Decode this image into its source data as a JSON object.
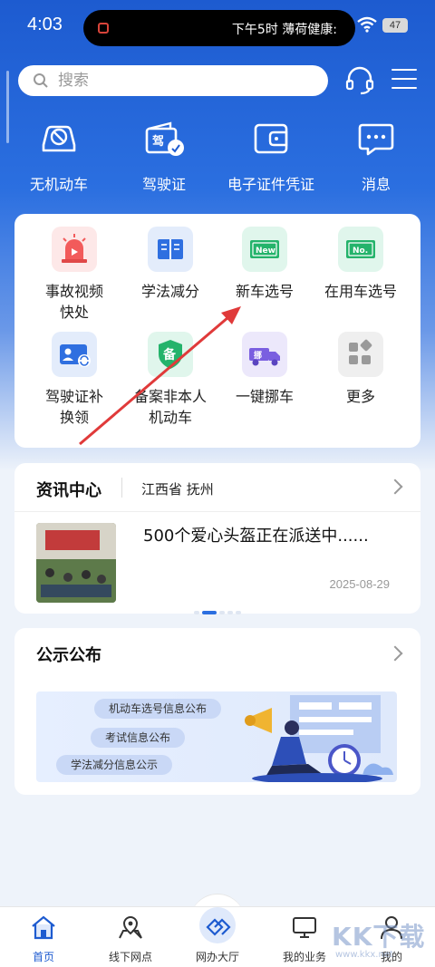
{
  "status_bar": {
    "time": "4:03",
    "notification": "下午5时 薄荷健康:",
    "battery": "47"
  },
  "search": {
    "placeholder": "搜索"
  },
  "top_services": [
    {
      "label": "无机动车",
      "icon": "no-vehicle-icon"
    },
    {
      "label": "驾驶证",
      "icon": "license-icon"
    },
    {
      "label": "电子证件凭证",
      "icon": "wallet-icon"
    },
    {
      "label": "消息",
      "icon": "message-icon"
    }
  ],
  "grid": [
    {
      "label": "事故视频快处",
      "icon": "alarm-video-icon",
      "color": "#fde8e8"
    },
    {
      "label": "学法减分",
      "icon": "book-icon",
      "color": "#e3ecfb"
    },
    {
      "label": "新车选号",
      "icon": "new-plate-icon",
      "color": "#e0f6ec"
    },
    {
      "label": "在用车选号",
      "icon": "no-plate-icon",
      "color": "#e0f6ec"
    },
    {
      "label": "驾驶证补换领",
      "icon": "license-renew-icon",
      "color": "#e3ecfb"
    },
    {
      "label": "备案非本人机动车",
      "icon": "record-shield-icon",
      "color": "#e0f6ec"
    },
    {
      "label": "一键挪车",
      "icon": "move-truck-icon",
      "color": "#ece8fb"
    },
    {
      "label": "更多",
      "icon": "more-grid-icon",
      "color": "#efefef"
    }
  ],
  "news": {
    "title": "资讯中心",
    "location": "江西省 抚州",
    "headline": "500个爱心头盔正在派送中......",
    "date": "2025-08-29"
  },
  "notice": {
    "title": "公示公布",
    "items": [
      "机动车选号信息公布",
      "考试信息公布",
      "学法减分信息公示"
    ]
  },
  "bottom_nav": [
    {
      "label": "首页",
      "icon": "home-icon",
      "active": true
    },
    {
      "label": "线下网点",
      "icon": "map-pin-icon",
      "active": false
    },
    {
      "label": "网办大厅",
      "icon": "online-hall-icon",
      "active": false
    },
    {
      "label": "我的业务",
      "icon": "monitor-icon",
      "active": false
    },
    {
      "label": "我的",
      "icon": "user-icon",
      "active": false
    }
  ],
  "watermark": {
    "big": "KK下载",
    "small": "www.kkx.net"
  },
  "colors": {
    "primary": "#1d5bd0",
    "accent_arrow": "#e03a3a"
  }
}
